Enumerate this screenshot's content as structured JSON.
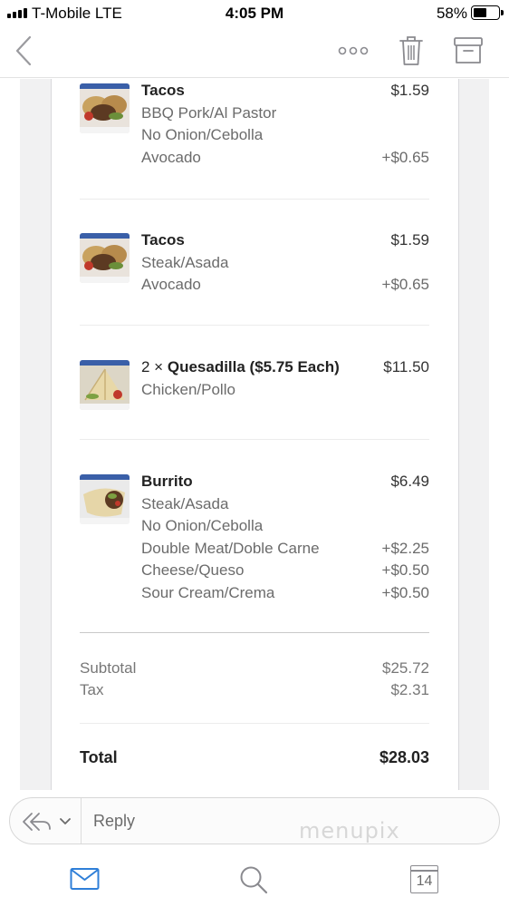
{
  "status_bar": {
    "carrier": "T-Mobile  LTE",
    "time": "4:05 PM",
    "battery": "58%",
    "battery_level": 0.58
  },
  "nav_bar": {
    "back_icon": "chevron-left-icon",
    "more_icon": "more-dots-icon",
    "trash_icon": "trash-icon",
    "archive_icon": "archive-icon"
  },
  "order": {
    "items": [
      {
        "title": "Tacos",
        "price": "$1.59",
        "image": "tacos-photo",
        "modifiers": [
          {
            "label": "BBQ Pork/Al Pastor",
            "price": ""
          },
          {
            "label": "No Onion/Cebolla",
            "price": ""
          },
          {
            "label": "Avocado",
            "price": "+$0.65"
          }
        ]
      },
      {
        "title": "Tacos",
        "price": "$1.59",
        "image": "tacos-photo",
        "modifiers": [
          {
            "label": "Steak/Asada",
            "price": ""
          },
          {
            "label": "Avocado",
            "price": "+$0.65"
          }
        ]
      },
      {
        "quantity": "2 ×",
        "title": "Quesadilla ($5.75 Each)",
        "price": "$11.50",
        "image": "quesadilla-photo",
        "modifiers": [
          {
            "label": "Chicken/Pollo",
            "price": ""
          }
        ]
      },
      {
        "title": "Burrito",
        "price": "$6.49",
        "image": "burrito-photo",
        "modifiers": [
          {
            "label": "Steak/Asada",
            "price": ""
          },
          {
            "label": "No Onion/Cebolla",
            "price": ""
          },
          {
            "label": "Double Meat/Doble Carne",
            "price": "+$2.25"
          },
          {
            "label": "Cheese/Queso",
            "price": "+$0.50"
          },
          {
            "label": "Sour Cream/Crema",
            "price": "+$0.50"
          }
        ]
      }
    ],
    "subtotal_label": "Subtotal",
    "subtotal": "$25.72",
    "tax_label": "Tax",
    "tax": "$2.31",
    "total_label": "Total",
    "total": "$28.03"
  },
  "reply_bar": {
    "reply_icon": "reply-all-icon",
    "chevron_icon": "chevron-down-icon",
    "reply_label": "Reply",
    "watermark": "menupix"
  },
  "tab_bar": {
    "mail_icon": "mail-icon",
    "search_icon": "search-icon",
    "calendar_icon": "calendar-icon",
    "calendar_day": "14"
  },
  "colors": {
    "accent": "#2f7fd8",
    "icon_gray": "#8a8a8f",
    "text_secondary": "#6b6b6b"
  }
}
